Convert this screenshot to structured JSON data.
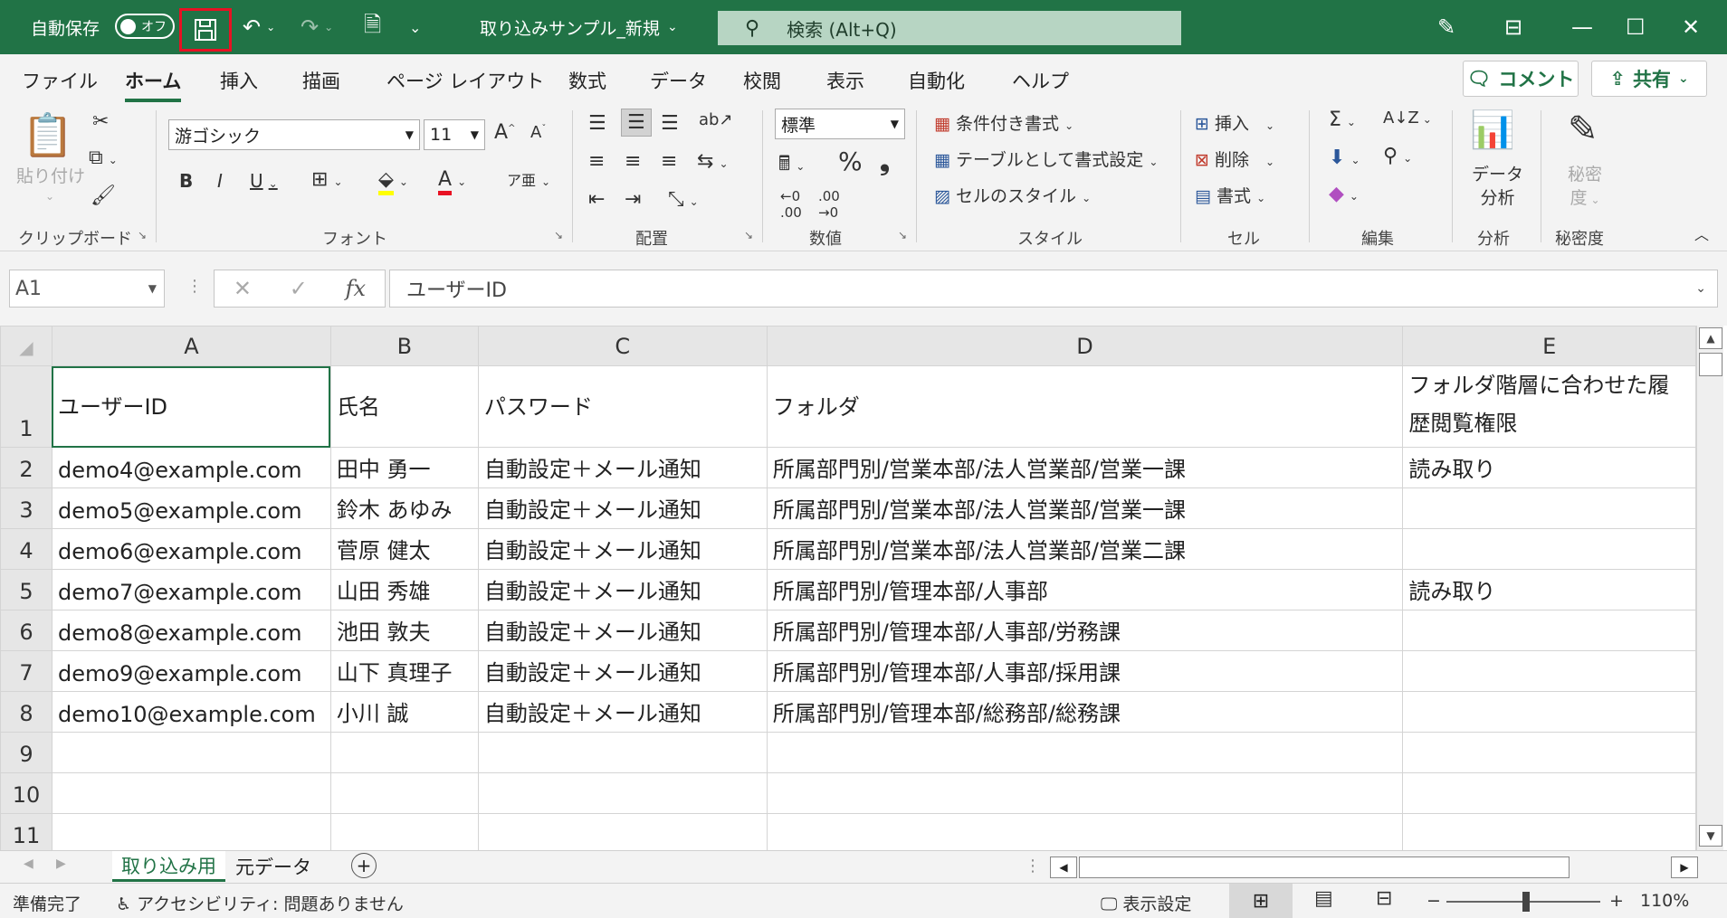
{
  "titlebar": {
    "autosave_label": "自動保存",
    "autosave_state": "オフ",
    "document_title": "取り込みサンプル_新規",
    "search_placeholder": "検索 (Alt+Q)"
  },
  "menu": {
    "tabs": [
      "ファイル",
      "ホーム",
      "挿入",
      "描画",
      "ページ レイアウト",
      "数式",
      "データ",
      "校閲",
      "表示",
      "自動化",
      "ヘルプ"
    ],
    "active_tab": "ホーム",
    "comment_label": "コメント",
    "share_label": "共有"
  },
  "ribbon": {
    "clipboard": {
      "paste_label": "貼り付け",
      "group_label": "クリップボード"
    },
    "font": {
      "font_name": "游ゴシック",
      "font_size": "11",
      "group_label": "フォント"
    },
    "alignment": {
      "group_label": "配置"
    },
    "number": {
      "format": "標準",
      "percent": "%",
      "comma": "❟",
      "group_label": "数値"
    },
    "styles": {
      "conditional": "条件付き書式",
      "as_table": "テーブルとして書式設定",
      "cell_styles": "セルのスタイル",
      "group_label": "スタイル"
    },
    "cells": {
      "insert": "挿入",
      "delete": "削除",
      "format": "書式",
      "group_label": "セル"
    },
    "editing": {
      "group_label": "編集"
    },
    "analysis": {
      "button_line1": "データ",
      "button_line2": "分析",
      "group_label": "分析"
    },
    "sensitivity": {
      "button_line1": "秘密",
      "button_line2": "度",
      "group_label": "秘密度"
    }
  },
  "formula_bar": {
    "name_box": "A1",
    "fx_label": "fx",
    "value": "ユーザーID"
  },
  "sheet": {
    "columns": [
      "A",
      "B",
      "C",
      "D",
      "E"
    ],
    "rows": [
      {
        "num": "1",
        "cells": [
          "ユーザーID",
          "氏名",
          "パスワード",
          "フォルダ",
          "フォルダ階層に合わせた履歴閲覧権限"
        ]
      },
      {
        "num": "2",
        "cells": [
          "demo4@example.com",
          "田中 勇一",
          "自動設定＋メール通知",
          "所属部門別/営業本部/法人営業部/営業一課",
          "読み取り"
        ]
      },
      {
        "num": "3",
        "cells": [
          "demo5@example.com",
          "鈴木 あゆみ",
          "自動設定＋メール通知",
          "所属部門別/営業本部/法人営業部/営業一課",
          ""
        ]
      },
      {
        "num": "4",
        "cells": [
          "demo6@example.com",
          "菅原 健太",
          "自動設定＋メール通知",
          "所属部門別/営業本部/法人営業部/営業二課",
          ""
        ]
      },
      {
        "num": "5",
        "cells": [
          "demo7@example.com",
          "山田 秀雄",
          "自動設定＋メール通知",
          "所属部門別/管理本部/人事部",
          "読み取り"
        ]
      },
      {
        "num": "6",
        "cells": [
          "demo8@example.com",
          "池田 敦夫",
          "自動設定＋メール通知",
          "所属部門別/管理本部/人事部/労務課",
          ""
        ]
      },
      {
        "num": "7",
        "cells": [
          "demo9@example.com",
          "山下 真理子",
          "自動設定＋メール通知",
          "所属部門別/管理本部/人事部/採用課",
          ""
        ]
      },
      {
        "num": "8",
        "cells": [
          "demo10@example.com",
          "小川 誠",
          "自動設定＋メール通知",
          "所属部門別/管理本部/総務部/総務課",
          ""
        ]
      },
      {
        "num": "9",
        "cells": [
          "",
          "",
          "",
          "",
          ""
        ]
      },
      {
        "num": "10",
        "cells": [
          "",
          "",
          "",
          "",
          ""
        ]
      },
      {
        "num": "11",
        "cells": [
          "",
          "",
          "",
          "",
          ""
        ]
      }
    ]
  },
  "sheet_tabs": {
    "tabs": [
      "取り込み用",
      "元データ"
    ],
    "active": "取り込み用"
  },
  "status": {
    "ready": "準備完了",
    "accessibility": "アクセシビリティ: 問題ありません",
    "display_settings": "表示設定",
    "zoom": "110%"
  },
  "colors": {
    "accent": "#217346",
    "highlight": "#e81123"
  }
}
